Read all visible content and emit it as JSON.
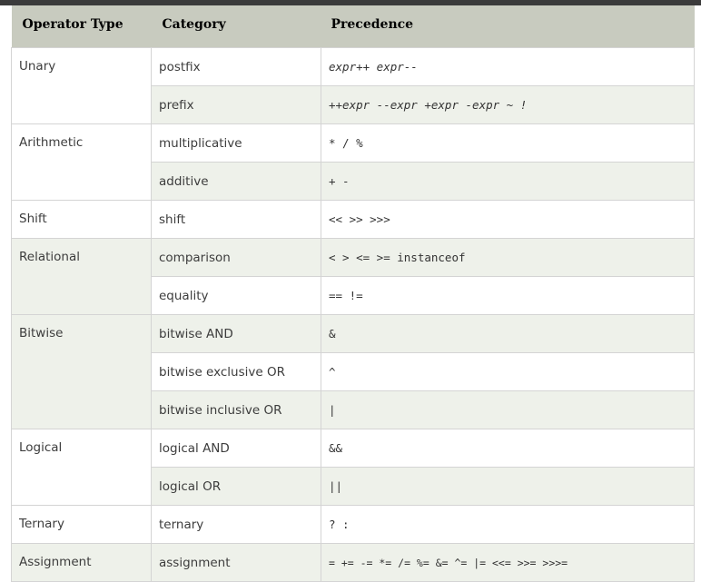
{
  "table": {
    "headers": [
      "Operator Type",
      "Category",
      "Precedence"
    ],
    "groups": [
      {
        "type": "Unary",
        "rows": [
          {
            "category": "postfix",
            "precedence": "expr++ expr--"
          },
          {
            "category": "prefix",
            "precedence": "++expr --expr +expr -expr ~ !"
          }
        ]
      },
      {
        "type": "Arithmetic",
        "rows": [
          {
            "category": "multiplicative",
            "precedence": "* / %"
          },
          {
            "category": "additive",
            "precedence": "+ -"
          }
        ]
      },
      {
        "type": "Shift",
        "rows": [
          {
            "category": "shift",
            "precedence": "<< >> >>>"
          }
        ]
      },
      {
        "type": "Relational",
        "rows": [
          {
            "category": "comparison",
            "precedence": "< > <= >= instanceof"
          },
          {
            "category": "equality",
            "precedence": "== !="
          }
        ]
      },
      {
        "type": "Bitwise",
        "rows": [
          {
            "category": "bitwise AND",
            "precedence": "&"
          },
          {
            "category": "bitwise exclusive OR",
            "precedence": "^"
          },
          {
            "category": "bitwise inclusive OR",
            "precedence": "|"
          }
        ]
      },
      {
        "type": "Logical",
        "rows": [
          {
            "category": "logical AND",
            "precedence": "&&"
          },
          {
            "category": "logical OR",
            "precedence": "||"
          }
        ]
      },
      {
        "type": "Ternary",
        "rows": [
          {
            "category": "ternary",
            "precedence": "? :"
          }
        ]
      },
      {
        "type": "Assignment",
        "rows": [
          {
            "category": "assignment",
            "precedence": "= += -= *= /= %= &= ^= |= <<= >>= >>>="
          }
        ]
      }
    ]
  }
}
